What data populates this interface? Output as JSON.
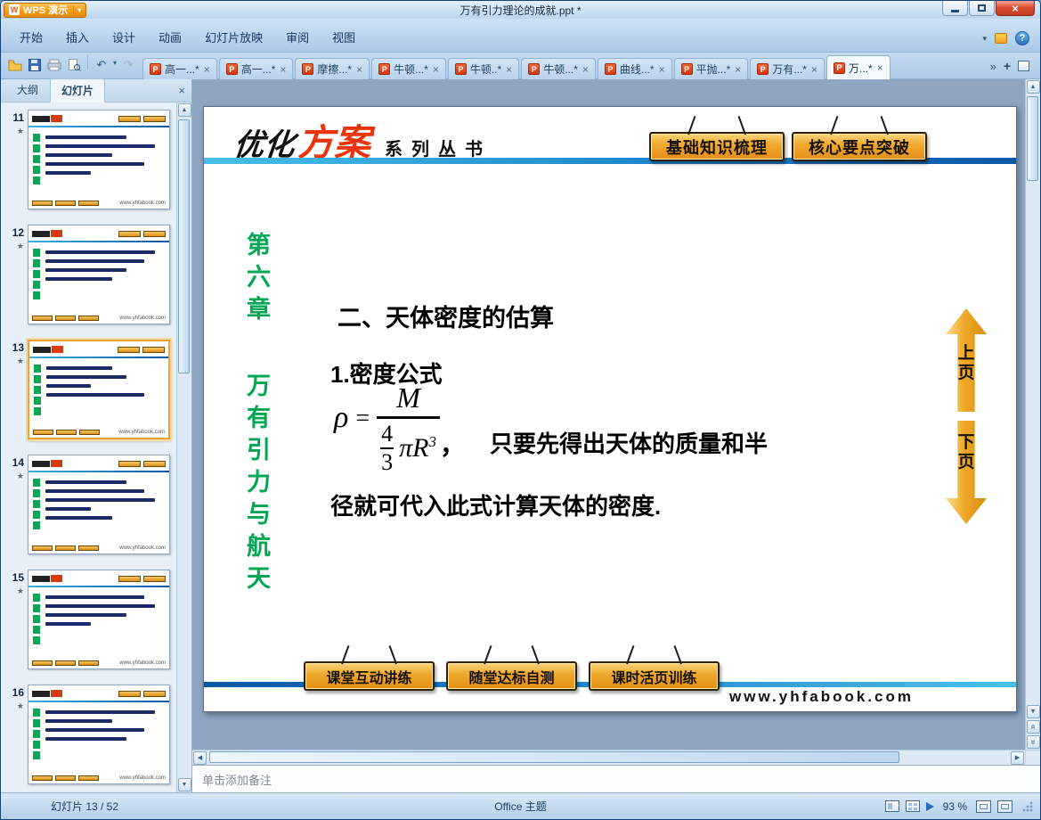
{
  "window": {
    "app_button": "WPS 演示",
    "title": "万有引力理论的成就.ppt *"
  },
  "icons": {
    "chevron_down": "▾",
    "close": "×",
    "overflow": "»",
    "new_tab": "+",
    "undo": "↶",
    "redo": "↷",
    "scroll_up": "▲",
    "scroll_down": "▼",
    "scroll_left": "◀",
    "scroll_right": "▶",
    "double_arrow": "»",
    "help": "?",
    "star": "★",
    "logo_letter": "W",
    "ppt_letter": "P"
  },
  "menu": {
    "tabs": [
      "开始",
      "插入",
      "设计",
      "动画",
      "幻灯片放映",
      "审阅",
      "视图"
    ]
  },
  "doc_bar": {
    "tabs": [
      {
        "label": "高一...*"
      },
      {
        "label": "高一...*"
      },
      {
        "label": "摩擦...*"
      },
      {
        "label": "牛顿...*"
      },
      {
        "label": "牛顿..*"
      },
      {
        "label": "牛顿...*"
      },
      {
        "label": "曲线...*"
      },
      {
        "label": "平抛...*"
      },
      {
        "label": "万有...*"
      },
      {
        "label": "万...*"
      }
    ]
  },
  "sidebar": {
    "outline_tab": "大纲",
    "slides_tab": "幻灯片",
    "thumbnails": [
      {
        "number": "11"
      },
      {
        "number": "12"
      },
      {
        "number": "13"
      },
      {
        "number": "14"
      },
      {
        "number": "15"
      },
      {
        "number": "16"
      }
    ],
    "site_caption": "www.yhfabook.com"
  },
  "slide": {
    "brand_black": "优化",
    "brand_red": "方案",
    "brand_series": "系列丛书",
    "top_buttons": [
      "基础知识梳理",
      "核心要点突破"
    ],
    "chapter": "第六章",
    "unit": "万有引力与航天",
    "heading": "二、天体密度的估算",
    "formula_label": "1.密度公式",
    "formula": {
      "lhs": "ρ",
      "equals": "=",
      "numerator": "M",
      "inner_numerator": "4",
      "inner_denominator": "3",
      "pi_term": "πR",
      "exponent": "3",
      "comma": "，"
    },
    "body_inline": "只要先得出天体的质量和半",
    "body_line2": "径就可代入此式计算天体的密度.",
    "nav_up": "上页",
    "nav_down": "下页",
    "bottom_buttons": [
      "课堂互动讲练",
      "随堂达标自测",
      "课时活页训练"
    ],
    "website": "www.yhfabook.com"
  },
  "notes": {
    "placeholder": "单击添加备注"
  },
  "status": {
    "slide_counter": "幻灯片 13 / 52",
    "theme": "Office 主题",
    "zoom": "93 %"
  }
}
